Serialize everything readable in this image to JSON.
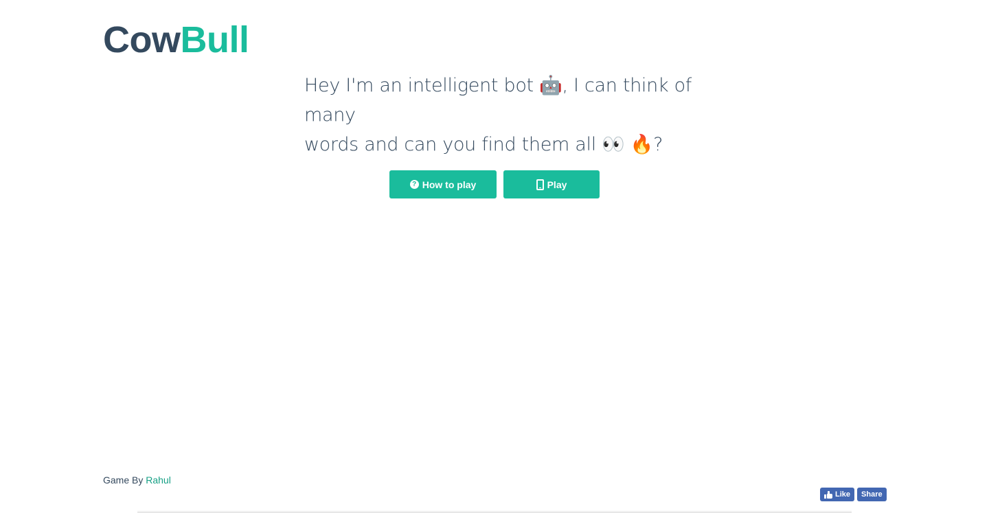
{
  "logo": {
    "part1": "Cow",
    "part2": "Bull"
  },
  "tagline": {
    "line1": "Hey I'm an intelligent bot 🤖, I can think of many",
    "line2": "words and can you find them all 👀 🔥?"
  },
  "buttons": {
    "how_to_play": {
      "label": "How to play",
      "icon": "question-circle-icon"
    },
    "play": {
      "label": "Play",
      "icon": "mobile-phone-icon"
    }
  },
  "footer": {
    "prefix": "Game By",
    "author": "Rahul"
  },
  "social": {
    "like_label": "Like",
    "share_label": "Share"
  },
  "colors": {
    "primary": "#1abc9c",
    "text": "#34495e",
    "link": "#16a085",
    "facebook": "#4267b2"
  }
}
